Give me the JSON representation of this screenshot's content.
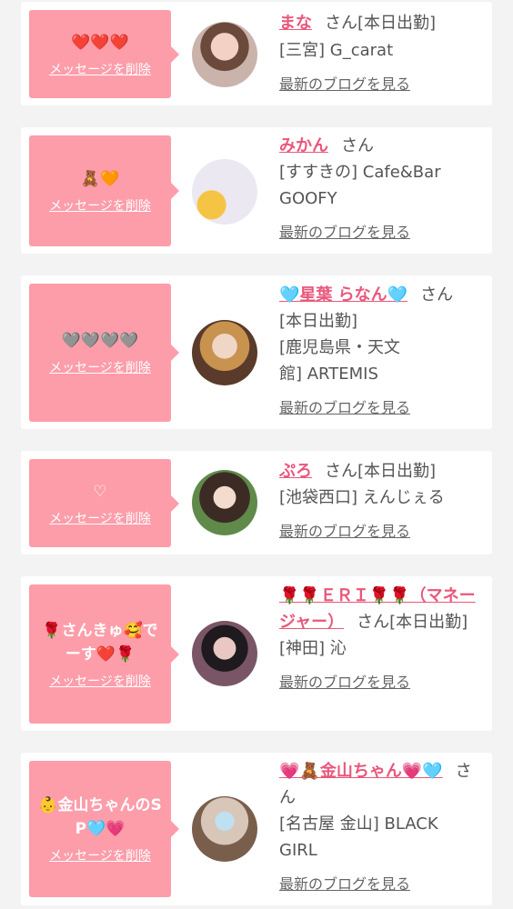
{
  "delete_label": "メッセージを削除",
  "blog_label": "最新のブログを見る",
  "san": "さん",
  "cards": [
    {
      "message": "❤️❤️❤️",
      "name": "まな",
      "status": "[本日出勤]",
      "line1": "[三宮] G_carat",
      "line2": "",
      "avatar_icon": "woman-avatar-icon"
    },
    {
      "message": "🧸🧡",
      "name": "みかん",
      "status": "",
      "line1": "[すすきの] Cafe&Bar",
      "line2": "GOOFY",
      "avatar_icon": "heart-avatar-icon"
    },
    {
      "message": "🩶🩶🩶🩶",
      "name": "🩵星葉 らなん🩵",
      "status": "",
      "line1": "[本日出勤]",
      "line2": "[鹿児島県・天文館] ARTEMIS",
      "avatar_icon": "woman-avatar-icon"
    },
    {
      "message": "♡",
      "name": "ぷろ",
      "status": "[本日出勤]",
      "line1": "[池袋西口] えんじぇる",
      "line2": "",
      "avatar_icon": "woman-avatar-icon"
    },
    {
      "message": "🌹さんきゅ🥰でーす❤️🌹",
      "name": "🌹🌹ＥＲＩ🌹🌹（マネージャー）",
      "status": "[本日出勤]",
      "line1": "[神田] 沁",
      "line2": "",
      "avatar_icon": "woman-avatar-icon"
    },
    {
      "message": "👶金山ちゃんのSP🩵💗",
      "name": "💗🧸金山ちゃん💗🩵",
      "status": "",
      "line1": "[名古屋 金山] BLACK",
      "line2": "GIRL",
      "avatar_icon": "woman-avatar-icon"
    }
  ]
}
